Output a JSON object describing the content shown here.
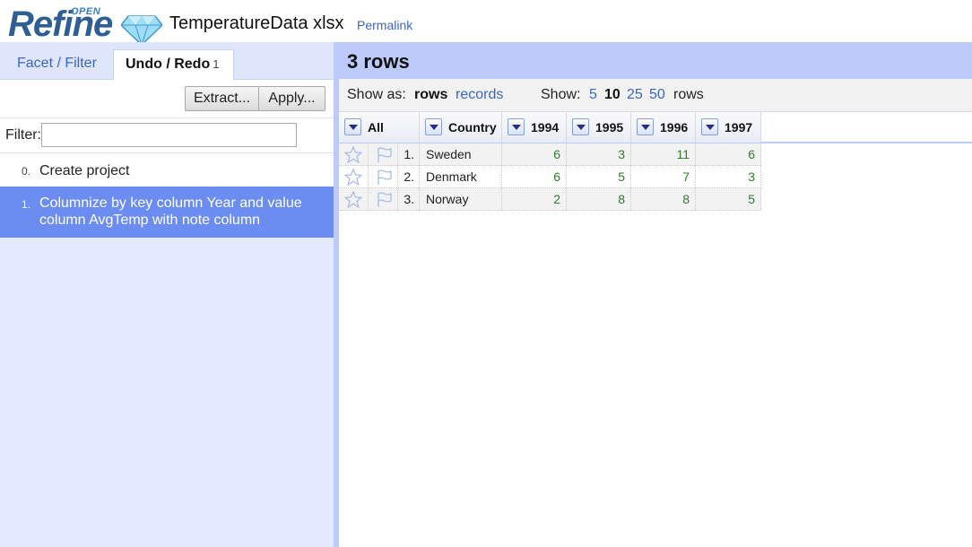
{
  "header": {
    "logo_text": "Refine",
    "logo_open": "OPEN",
    "project_title": "TemperatureData xlsx",
    "permalink_label": "Permalink"
  },
  "left_panel": {
    "tabs": [
      {
        "label": "Facet / Filter"
      },
      {
        "label": "Undo / Redo",
        "count": "1"
      }
    ],
    "buttons": {
      "extract": "Extract...",
      "apply": "Apply..."
    },
    "filter": {
      "label": "Filter:",
      "value": ""
    },
    "history": [
      {
        "index": "0.",
        "text": "Create project"
      },
      {
        "index": "1.",
        "text": "Columnize by key column Year and value column AvgTemp with note column"
      }
    ]
  },
  "right_panel": {
    "row_count": "3 rows",
    "view": {
      "show_as_label": "Show as:",
      "mode_rows": "rows",
      "mode_records": "records",
      "show_label": "Show:",
      "sizes": [
        "5",
        "10",
        "25",
        "50"
      ],
      "rows_word": "rows"
    },
    "columns": [
      "All",
      "Country",
      "1994",
      "1995",
      "1996",
      "1997"
    ],
    "rows": [
      {
        "index": "1.",
        "country": "Sweden",
        "values": [
          "6",
          "3",
          "11",
          "6"
        ]
      },
      {
        "index": "2.",
        "country": "Denmark",
        "values": [
          "6",
          "5",
          "7",
          "3"
        ]
      },
      {
        "index": "3.",
        "country": "Norway",
        "values": [
          "2",
          "8",
          "8",
          "5"
        ]
      }
    ]
  },
  "colors": {
    "accent_blue": "#bccbfa",
    "selected_history": "#6b8cf0",
    "link_blue": "#3a66c3",
    "number_green": "#2e7d2e"
  }
}
